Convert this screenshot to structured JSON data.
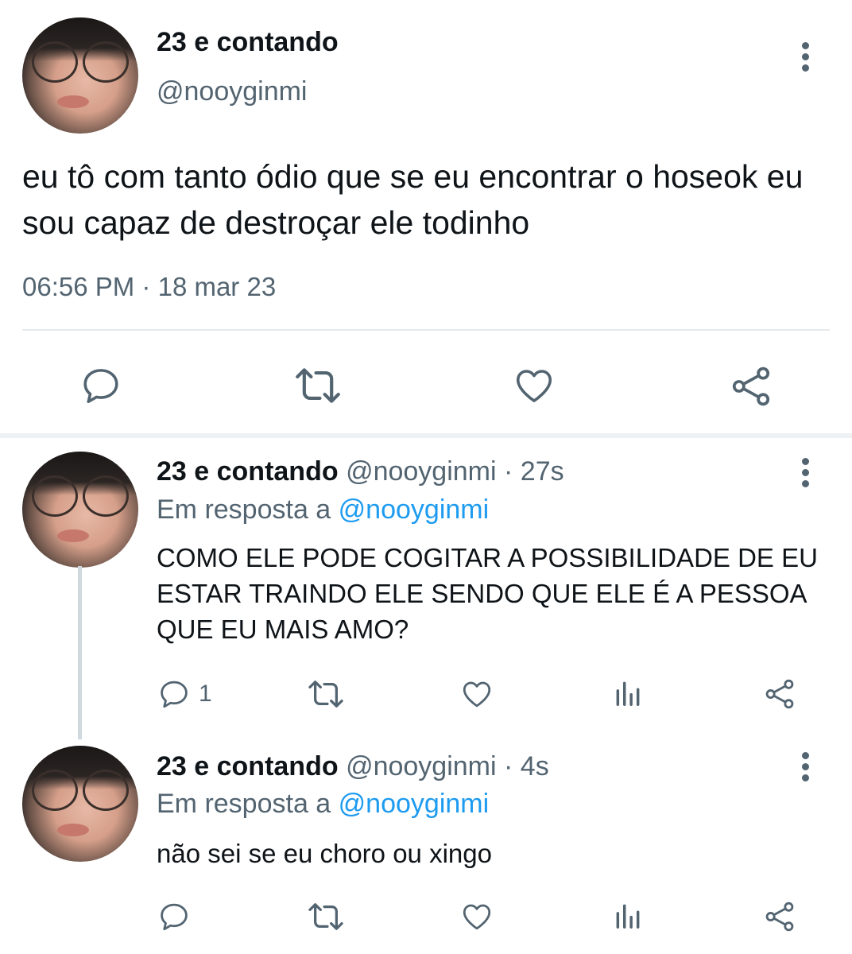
{
  "main_tweet": {
    "display_name": "23 e contando",
    "handle": "@nooyginmi",
    "text": "eu tô com tanto ódio que se eu encontrar o hoseok eu sou capaz de destroçar ele todinho",
    "time": "06:56 PM",
    "date": "18 mar 23",
    "actions": [
      "reply-icon",
      "retweet-icon",
      "like-icon",
      "share-icon"
    ]
  },
  "replies": [
    {
      "display_name": "23 e contando",
      "handle": "@nooyginmi",
      "age": "27s",
      "reply_prefix": "Em resposta a",
      "reply_target": "@nooyginmi",
      "text": "COMO ELE PODE COGITAR A POSSIBILIDADE DE EU ESTAR TRAINDO ELE SENDO QUE ELE É A PESSOA QUE EU MAIS AMO?",
      "reply_count": "1"
    },
    {
      "display_name": "23 e contando",
      "handle": "@nooyginmi",
      "age": "4s",
      "reply_prefix": "Em resposta a",
      "reply_target": "@nooyginmi",
      "text": "não sei se eu choro ou xingo"
    }
  ],
  "colors": {
    "text": "#0f1419",
    "secondary": "#536471",
    "link": "#1d9bf0",
    "divider": "#e6e9ec"
  }
}
